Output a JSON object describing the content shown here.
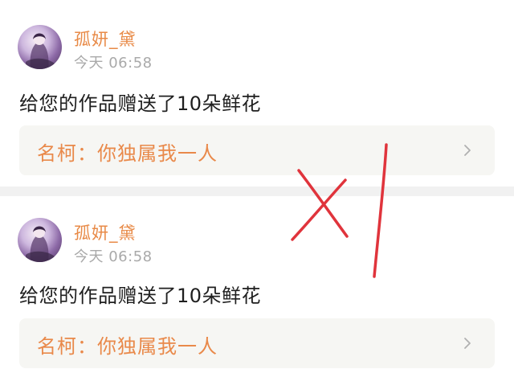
{
  "notifications": [
    {
      "username": "孤妍_黛",
      "timestamp": "今天 06:58",
      "message": "给您的作品赠送了10朵鲜花",
      "work_title": "名柯：你独属我一人"
    },
    {
      "username": "孤妍_黛",
      "timestamp": "今天 06:58",
      "message": "给您的作品赠送了10朵鲜花",
      "work_title": "名柯：你独属我一人"
    }
  ],
  "colors": {
    "accent": "#e88a47",
    "timestamp": "#a9a9a9",
    "link_background": "#f6f6f3",
    "separator": "#f1f1f1",
    "annotation": "#e0343c"
  },
  "icons": {
    "link_arrow": "chevron-right-icon"
  }
}
